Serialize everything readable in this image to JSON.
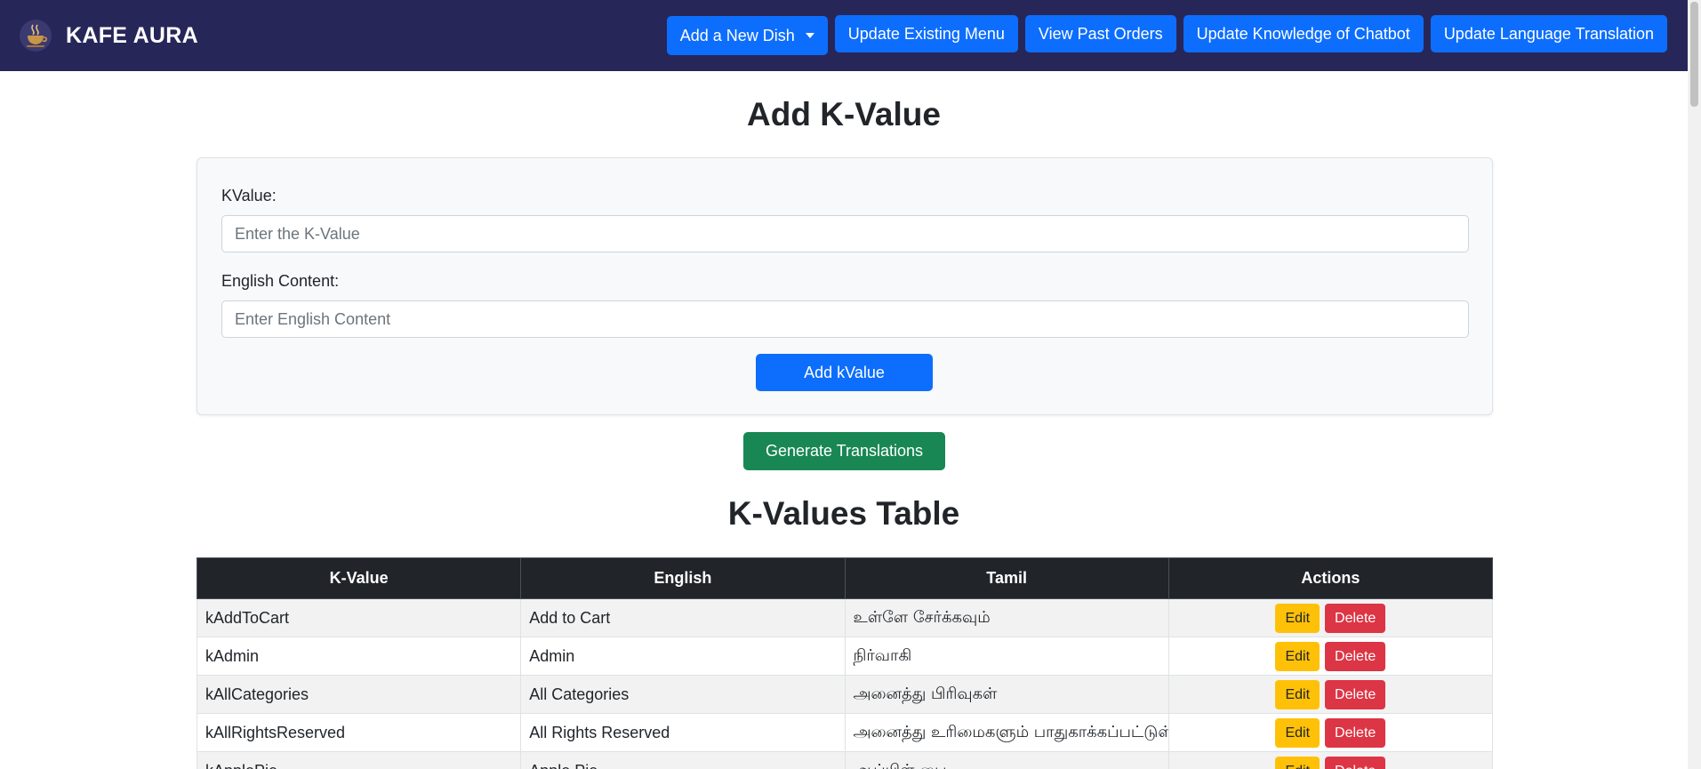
{
  "brand": {
    "name": "KAFE AURA",
    "logo_icon": "coffee-cup-icon"
  },
  "nav": {
    "add_dish": "Add a New Dish",
    "update_menu": "Update Existing Menu",
    "past_orders": "View Past Orders",
    "update_knowledge": "Update Knowledge of Chatbot",
    "update_translation": "Update Language Translation"
  },
  "form": {
    "title": "Add K-Value",
    "kvalue_label": "KValue:",
    "kvalue_placeholder": "Enter the K-Value",
    "kvalue_value": "",
    "english_label": "English Content:",
    "english_placeholder": "Enter English Content",
    "english_value": "",
    "submit_label": "Add kValue"
  },
  "generate_label": "Generate Translations",
  "table": {
    "title": "K-Values Table",
    "headers": [
      "K-Value",
      "English",
      "Tamil",
      "Actions"
    ],
    "edit_label": "Edit",
    "delete_label": "Delete",
    "rows": [
      {
        "key": "kAddToCart",
        "english": "Add to Cart",
        "tamil": "உள்ளே சேர்க்கவும்"
      },
      {
        "key": "kAdmin",
        "english": "Admin",
        "tamil": "நிர்வாகி"
      },
      {
        "key": "kAllCategories",
        "english": "All Categories",
        "tamil": "அனைத்து பிரிவுகள்"
      },
      {
        "key": "kAllRightsReserved",
        "english": "All Rights Reserved",
        "tamil": "அனைத்து உரிமைகளும் பாதுகாக்கப்பட்டுள்ளன"
      },
      {
        "key": "kApplePie",
        "english": "Apple Pie",
        "tamil": "ஆப்பிள் பை"
      }
    ]
  },
  "colors": {
    "navbar": "#272659",
    "primary": "#0d6efd",
    "success": "#198754",
    "warning": "#ffc107",
    "danger": "#dc3545",
    "table_header": "#212529"
  }
}
